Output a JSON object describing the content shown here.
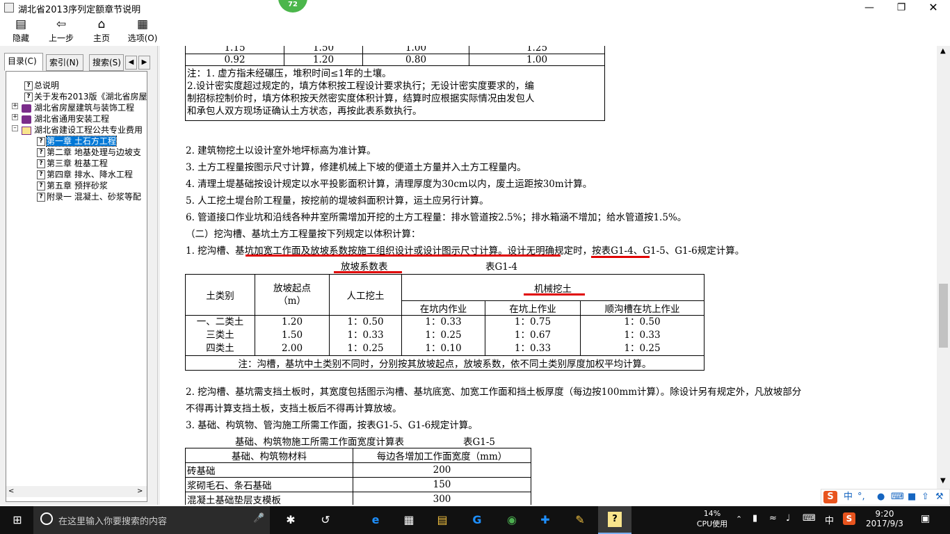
{
  "window": {
    "title": "湖北省2013序列定额章节说明",
    "badge": "72"
  },
  "toolbar": {
    "hide": "隐藏",
    "back": "上一步",
    "home": "主页",
    "options": "选项(O)"
  },
  "tabs": {
    "contents": "目录(C)",
    "index": "索引(N)",
    "search": "搜索(S)"
  },
  "tree": [
    {
      "label": "总说明"
    },
    {
      "label": "关于发布2013版《湖北省房屋"
    },
    {
      "label": "湖北省房屋建筑与装饰工程"
    },
    {
      "label": "湖北省通用安装工程"
    },
    {
      "label": "湖北省建设工程公共专业费用"
    },
    {
      "label": "第一章 土石方工程"
    },
    {
      "label": "第二章 地基处理与边坡支"
    },
    {
      "label": "第三章 桩基工程"
    },
    {
      "label": "第四章 排水、降水工程"
    },
    {
      "label": "第五章 预拌砂浆"
    },
    {
      "label": "附录一 混凝土、砂浆等配"
    }
  ],
  "top_table": {
    "rows": [
      [
        "1.15",
        "1.50",
        "1.00",
        "1.25"
      ],
      [
        "0.92",
        "1.20",
        "0.80",
        "1.00"
      ]
    ],
    "note1": "注：1. 虚方指未经碾压，堆积时间≤1年的土壤。",
    "note2": "2.设计密实度超过规定的，填方体积按工程设计要求执行；无设计密实度要求的，编",
    "note3": "制招标控制价时，填方体积按天然密实度体积计算，结算时应根据实际情况由发包人",
    "note4": "和承包人双方现场证确认土方状态，再按此表系数执行。"
  },
  "paragraphs": {
    "p2": "2. 建筑物挖土以设计室外地坪标高为准计算。",
    "p3": "3. 土方工程量按图示尺寸计算，修建机械上下坡的便道土方量并入土方工程量内。",
    "p4": "4. 清理土堤基础按设计规定以水平投影面积计算，清理厚度为30cm以内，废土运距按30m计算。",
    "p5": "5. 人工挖土堤台阶工程量，按挖前的堤坡斜面积计算，运土应另行计算。",
    "p6": "6. 管道接口作业坑和沿线各种井室所需增加开挖的土方工程量：排水管道按2.5%；排水箱涵不增加；给水管道按1.5%。",
    "h2": "（二）挖沟槽、基坑土方工程量按下列规定以体积计算：",
    "p7": "1. 挖沟槽、基坑加宽工作面及放坡系数按施工组织设计或设计图示尺寸计算。设计无明确规定时，按表G1-4、G1-5、G1-6规定计算。",
    "p8a": "2. 挖沟槽、基坑需支挡土板时，其宽度包括图示沟槽、基坑底宽、加宽工作面和挡土板厚度（每边按100mm计算）。除设计另有规定外，凡放坡部分",
    "p8b": "不得再计算支挡土板，支挡土板后不得再计算放坡。",
    "p9": "3. 基础、构筑物、管沟施工所需工作面，按表G1-5、G1-6规定计算。"
  },
  "table_g14": {
    "title": "放坡系数表",
    "code": "表G1-4",
    "h_soil": "土类别",
    "h_start": "放坡起点",
    "h_unit": "（m）",
    "h_manual": "人工挖土",
    "h_mech": "机械挖土",
    "h_in": "在坑内作业",
    "h_on": "在坑上作业",
    "h_along": "顺沟槽在坑上作业",
    "rows": [
      [
        "一、二类土",
        "1.20",
        "1：0.50",
        "1：0.33",
        "1：0.75",
        "1：0.50"
      ],
      [
        "三类土",
        "1.50",
        "1：0.33",
        "1：0.25",
        "1：0.67",
        "1：0.33"
      ],
      [
        "四类土",
        "2.00",
        "1：0.25",
        "1：0.10",
        "1：0.33",
        "1：0.25"
      ]
    ],
    "note": "注：沟槽，基坑中土类别不同时，分别按其放坡起点，放坡系数，依不同土类别厚度加权平均计算。"
  },
  "table_g15": {
    "title": "基础、构筑物施工所需工作面宽度计算表",
    "code": "表G1-5",
    "h_mat": "基础、构筑物材料",
    "h_width": "每边各增加工作面宽度（mm）",
    "rows": [
      [
        "砖基础",
        "200"
      ],
      [
        "浆砌毛石、条石基础",
        "150"
      ],
      [
        "混凝土基础垫层支模板",
        "300"
      ]
    ]
  },
  "taskbar": {
    "search_placeholder": "在这里输入你要搜索的内容",
    "cpu_percent": "14%",
    "cpu_label": "CPU使用",
    "ime": "中",
    "time": "9:20",
    "date": "2017/9/3"
  },
  "imebar": {
    "lang": "中"
  }
}
